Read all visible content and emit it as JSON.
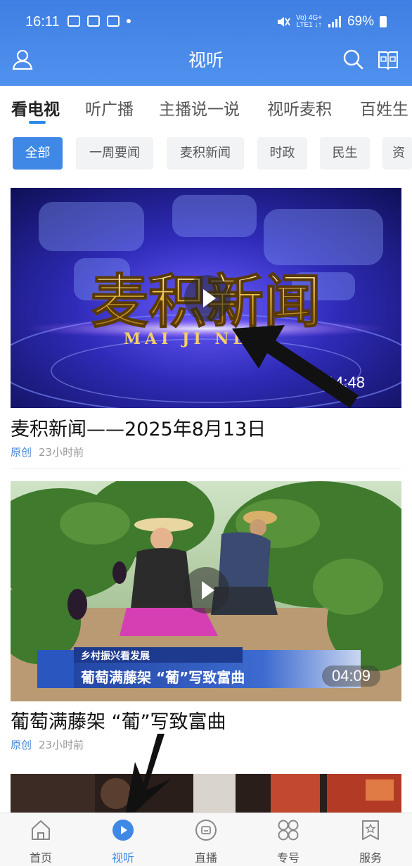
{
  "status_bar": {
    "time": "16:11",
    "net1": "Vo) 4G+",
    "net2": "LTE1 ↓↑",
    "battery": "69%"
  },
  "header": {
    "title": "视听"
  },
  "tabs": [
    {
      "label": "看电视",
      "active": true
    },
    {
      "label": "听广播"
    },
    {
      "label": "主播说一说"
    },
    {
      "label": "视听麦积"
    },
    {
      "label": "百姓生"
    }
  ],
  "chips": [
    {
      "label": "全部",
      "active": true
    },
    {
      "label": "一周要闻"
    },
    {
      "label": "麦积新闻"
    },
    {
      "label": "时政"
    },
    {
      "label": "民生"
    },
    {
      "label": "资"
    }
  ],
  "videos": [
    {
      "logo_cn": "麦积新闻",
      "logo_en": "MAI JI NE",
      "duration": "14:48",
      "title": "麦积新闻——2025年8月13日",
      "tag": "原创",
      "time": "23小时前"
    },
    {
      "banner_small": "乡村振兴看发展",
      "banner_big": "葡萄满藤架 “葡”写致富曲",
      "duration": "04:09",
      "title": "葡萄满藤架 “葡”写致富曲",
      "tag": "原创",
      "time": "23小时前"
    }
  ],
  "bottom_nav": [
    {
      "label": "首页",
      "icon": "home-icon"
    },
    {
      "label": "视听",
      "icon": "play-circle-icon",
      "active": true
    },
    {
      "label": "直播",
      "icon": "live-tv-icon"
    },
    {
      "label": "专号",
      "icon": "grid-circles-icon"
    },
    {
      "label": "服务",
      "icon": "service-star-icon"
    }
  ],
  "colors": {
    "header": "#4a8ae9",
    "accent": "#3f88e6"
  }
}
